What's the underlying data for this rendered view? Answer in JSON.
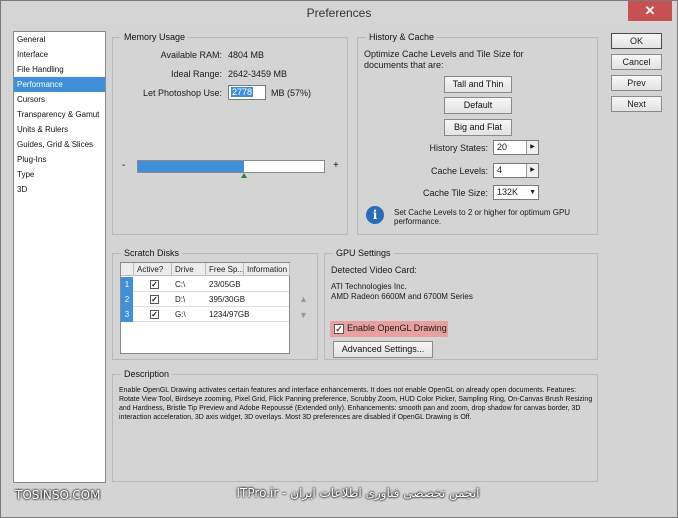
{
  "window": {
    "title": "Preferences",
    "close_glyph": "✕"
  },
  "sidebar": {
    "items": [
      {
        "label": "General"
      },
      {
        "label": "Interface"
      },
      {
        "label": "File Handling"
      },
      {
        "label": "Performance",
        "selected": true
      },
      {
        "label": "Cursors"
      },
      {
        "label": "Transparency & Gamut"
      },
      {
        "label": "Units & Rulers"
      },
      {
        "label": "Guides, Grid & Slices"
      },
      {
        "label": "Plug-Ins"
      },
      {
        "label": "Type"
      },
      {
        "label": "3D"
      }
    ]
  },
  "buttons": {
    "ok": "OK",
    "cancel": "Cancel",
    "prev": "Prev",
    "next": "Next"
  },
  "memory": {
    "title": "Memory Usage",
    "available_label": "Available RAM:",
    "available_value": "4804 MB",
    "ideal_label": "Ideal Range:",
    "ideal_value": "2642-3459 MB",
    "let_label": "Let Photoshop Use:",
    "let_value": "2778",
    "let_suffix": "MB (57%)",
    "slider_minus": "-",
    "slider_plus": "+",
    "slider_fraction": 0.57
  },
  "history": {
    "title": "History & Cache",
    "intro": "Optimize Cache Levels and Tile Size for documents that are:",
    "tall_thin": "Tall and Thin",
    "default": "Default",
    "big_flat": "Big and Flat",
    "states_label": "History States:",
    "states_value": "20",
    "levels_label": "Cache Levels:",
    "levels_value": "4",
    "tile_label": "Cache Tile Size:",
    "tile_value": "132K",
    "info_text": "Set Cache Levels to 2 or higher for optimum GPU performance.",
    "info_glyph": "i"
  },
  "scratch": {
    "title": "Scratch Disks",
    "headers": [
      "Active?",
      "Drive",
      "Free Sp...",
      "Information"
    ],
    "rows": [
      {
        "num": "1",
        "drive": "C:\\",
        "free": "23/05GB",
        "info": ""
      },
      {
        "num": "2",
        "drive": "D:\\",
        "free": "395/30GB",
        "info": ""
      },
      {
        "num": "3",
        "drive": "G:\\",
        "free": "1234/97GB",
        "info": ""
      }
    ],
    "check_glyph": "✓",
    "up_glyph": "▲",
    "down_glyph": "▼"
  },
  "gpu": {
    "title": "GPU Settings",
    "detected_label": "Detected Video Card:",
    "card_line1": "ATI Technologies Inc.",
    "card_line2": "AMD Radeon 6600M and 6700M Series",
    "opengl_label": "Enable OpenGL Drawing",
    "opengl_glyph": "✓",
    "advanced": "Advanced Settings..."
  },
  "description": {
    "title": "Description",
    "text": "Enable OpenGL Drawing activates certain features and interface enhancements. It does not enable OpenGL on already open documents. Features: Rotate View Tool, Birdseye zooming, Pixel Grid, Flick Panning preference, Scrubby Zoom, HUD Color Picker, Sampling Ring, On-Canvas Brush Resizing and Hardness, Bristle Tip Preview and Adobe Repoussé (Extended only). Enhancements: smooth pan and zoom, drop shadow for canvas border, 3D interaction acceleration, 3D axis widget, 3D overlays. Most 3D preferences are disabled if OpenGL Drawing is Off."
  },
  "watermark": {
    "left": "TOSINSO.COM",
    "center": "ITPro.ir - انجمن تخصصی فناوری اطلاعات ایران"
  }
}
